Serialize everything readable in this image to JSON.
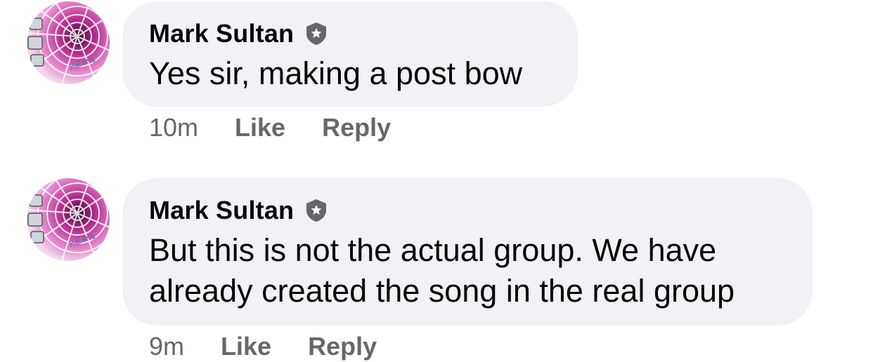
{
  "comments": [
    {
      "author": "Mark Sultan",
      "badge_icon": "admin-badge-icon",
      "text_lines": [
        "Yes sir, making a post bow"
      ],
      "time": "10m",
      "like_label": "Like",
      "reply_label": "Reply"
    },
    {
      "author": "Mark Sultan",
      "badge_icon": "admin-badge-icon",
      "text_lines": [
        "But this is not the actual group. We have",
        "already created the song in the real group"
      ],
      "time": "9m",
      "like_label": "Like",
      "reply_label": "Reply"
    }
  ],
  "colors": {
    "bubble": "#f0f2f5",
    "text": "#050505",
    "meta": "#65676b",
    "badge": "#65676b",
    "avatar_accent": "#c2389b"
  }
}
